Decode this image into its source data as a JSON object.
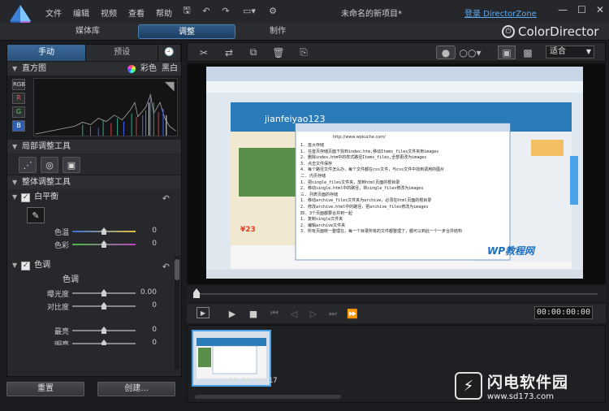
{
  "window": {
    "title": "未命名的新项目*",
    "login_link": "登录 DirectorZone",
    "min": "—",
    "max": "☐",
    "close": "✕"
  },
  "menu": [
    "文件",
    "编辑",
    "视频",
    "查看",
    "帮助"
  ],
  "mode_tabs": [
    "媒体库",
    "调整",
    "制作"
  ],
  "brand": "ColorDirector",
  "left_panel": {
    "subtabs": [
      "手动",
      "预设"
    ],
    "histogram": {
      "title": "直方图",
      "opt_color": "彩色",
      "opt_bw": "黑白",
      "channels": [
        "RGB",
        "R",
        "G",
        "B"
      ]
    },
    "local_tools": {
      "title": "局部调整工具"
    },
    "global_tools": {
      "title": "整体调整工具"
    },
    "white_balance": {
      "title": "白平衡",
      "sliders": [
        {
          "label": "色温",
          "value": "0",
          "pos": 0.5
        },
        {
          "label": "色彩",
          "value": "0",
          "pos": 0.5
        }
      ]
    },
    "tone": {
      "title": "色调",
      "sub": "色调",
      "sliders": [
        {
          "label": "曝光度",
          "value": "0.00",
          "pos": 0.5
        },
        {
          "label": "对比度",
          "value": "0",
          "pos": 0.5
        },
        {
          "label": "最亮",
          "value": "0",
          "pos": 0.5
        },
        {
          "label": "明亮",
          "value": "0",
          "pos": 0.5
        }
      ]
    },
    "reset_button": "重置",
    "create_button": "创建..."
  },
  "viewer": {
    "zoom_select": "适合",
    "timecode": "00:00:00:00",
    "clip_time": "00:11:38:17"
  },
  "screen_content": {
    "url": "http://www.wpkuche.com/",
    "lines": [
      "1. 首页存储",
      "1. 在首页存储页面下找到index.htm,移动Items_files文件夹到images",
      "2. 删除index.htm中的样式路径Items_files,全部更改为images",
      "3. 点击文件保存",
      "4. 每个路径文件怎么办，每个文件都在css文件，与css文件中找到调用的图片",
      "二. 内页存储",
      "1. 把single_files文件夹，放到html页面的根目录",
      "2. 移动single.html中的路径，将single_files修改为images",
      "三. 列表页面的存储",
      "1. 移动archive_files文件夹为archive，必须在html页面的根目录",
      "2. 修改archive.html中的路径，把archive_files修改为images",
      "四. 3个页面都要合并到一起",
      "1. 复制single文件夹",
      "2. 编辑archive文件夹",
      "3. 所有页面统一整理在，每一个目录所有的文件都整理了，都可以到此一个一步合并结构"
    ],
    "watermark_wp": "WP教程网",
    "price": "¥23",
    "brand_text": "jianfeiyao123"
  },
  "watermark": {
    "badge": "⚡",
    "cn": "闪电软件园",
    "url": "www.sd173.com"
  },
  "colors": {
    "accent": "#4aa3e8",
    "bg": "#1b1c1f",
    "panel": "#26282c"
  }
}
